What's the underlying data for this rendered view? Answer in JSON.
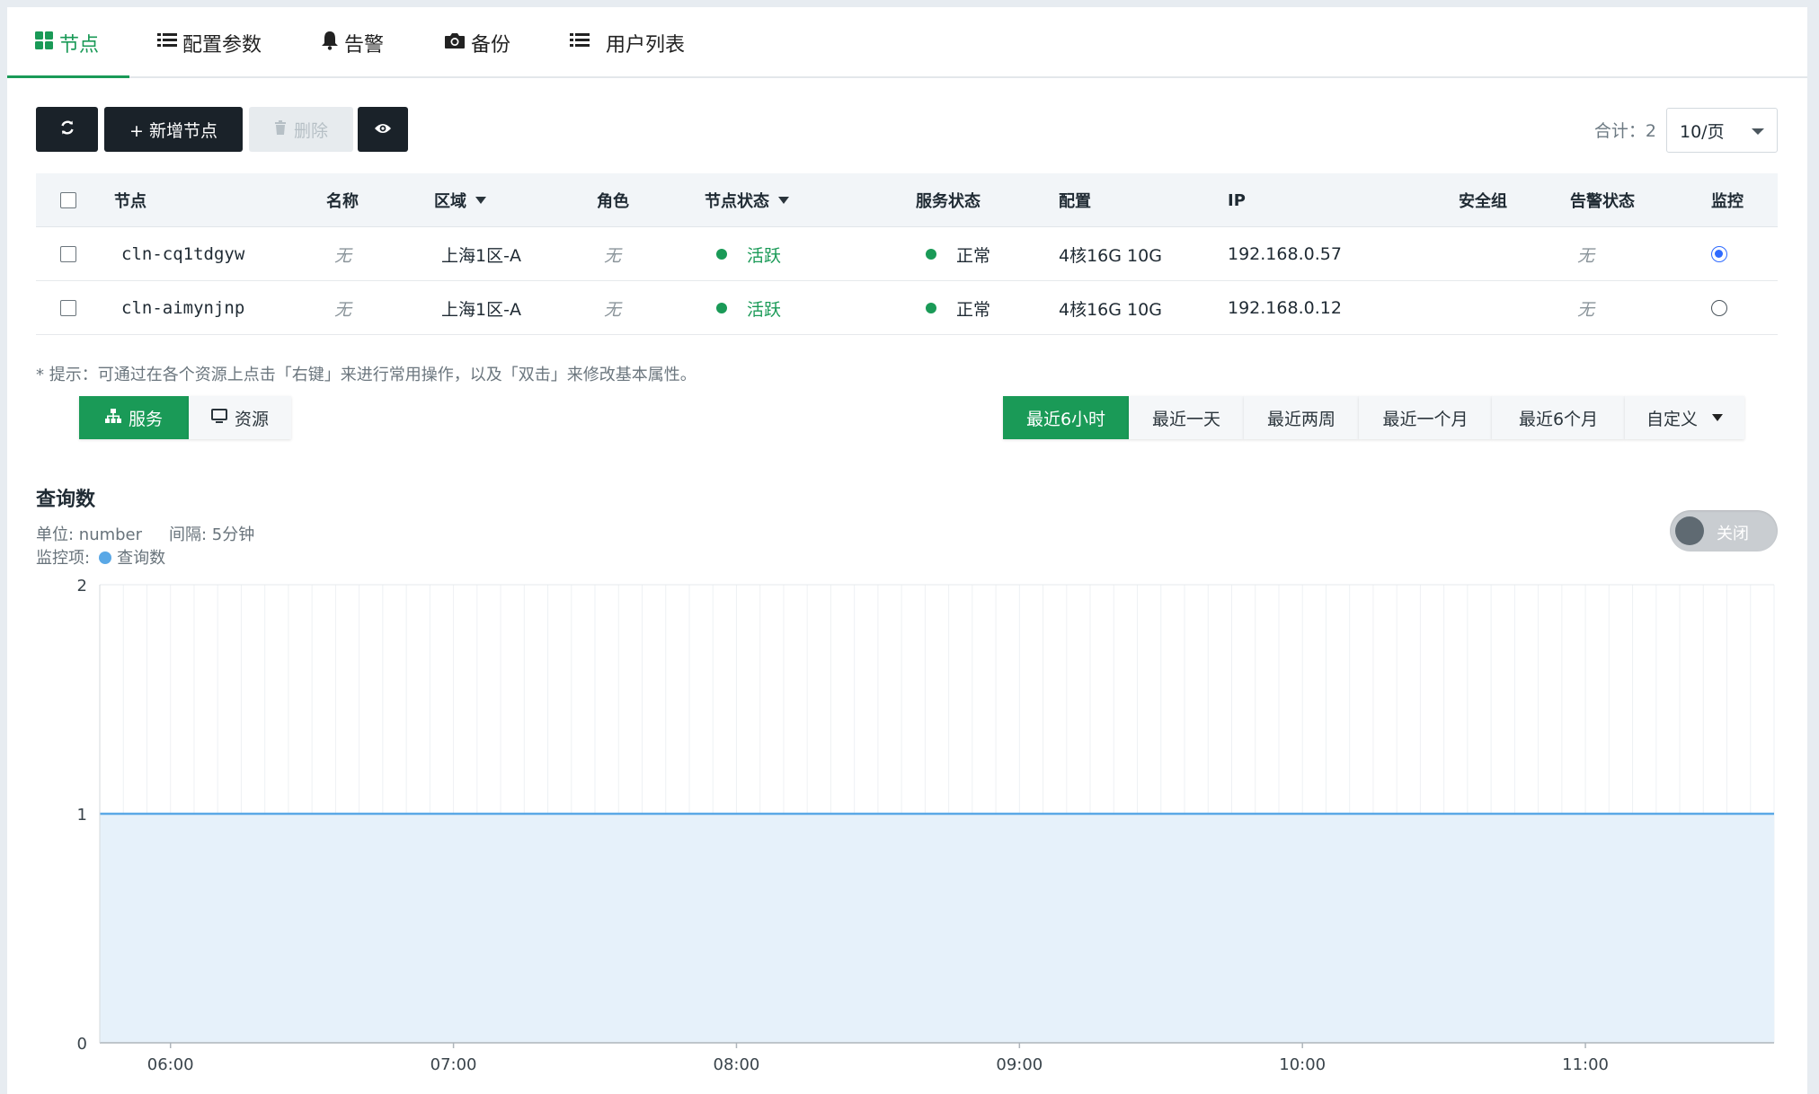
{
  "tabs": [
    {
      "label": "节点",
      "icon": "grid-icon"
    },
    {
      "label": "配置参数",
      "icon": "list-icon"
    },
    {
      "label": "告警",
      "icon": "bell-icon"
    },
    {
      "label": "备份",
      "icon": "camera-icon"
    },
    {
      "label": "用户列表",
      "icon": "list-icon"
    }
  ],
  "toolbar": {
    "refresh_icon": "refresh-icon",
    "add_label": "+ 新增节点",
    "delete_label": "删除",
    "view_icon": "eye-icon",
    "total_label": "合计：2",
    "page_size": "10/页"
  },
  "table": {
    "headers": [
      "节点",
      "名称",
      "区域",
      "角色",
      "节点状态",
      "服务状态",
      "配置",
      "IP",
      "安全组",
      "告警状态",
      "监控"
    ],
    "rows": [
      {
        "node": "cln-cq1tdgyw",
        "name": "无",
        "zone": "上海1区-A",
        "role": "无",
        "node_status": "活跃",
        "service_status": "正常",
        "config": "4核16G 10G",
        "ip": "192.168.0.57",
        "security_group": "",
        "alert_status": "无",
        "monitor_selected": true
      },
      {
        "node": "cln-aimynjnp",
        "name": "无",
        "zone": "上海1区-A",
        "role": "无",
        "node_status": "活跃",
        "service_status": "正常",
        "config": "4核16G 10G",
        "ip": "192.168.0.12",
        "security_group": "",
        "alert_status": "无",
        "monitor_selected": false
      }
    ]
  },
  "hint": "* 提示：可通过在各个资源上点击「右键」来进行常用操作，以及「双击」来修改基本属性。",
  "view_tabs": [
    "服务",
    "资源"
  ],
  "time_ranges": [
    "最近6小时",
    "最近一天",
    "最近两周",
    "最近一个月",
    "最近6个月",
    "自定义"
  ],
  "chart_meta": {
    "unit": "单位: number",
    "interval": "间隔: 5分钟",
    "monitor_label": "监控项:",
    "series_label": "查询数",
    "toggle_label": "关闭"
  },
  "colors": {
    "accent": "#1a9a57",
    "series": "#5aa8e6",
    "fill": "#e6f1fa"
  },
  "chart_data": {
    "type": "area",
    "title": "查询数",
    "x": [
      "05:45",
      "11:40"
    ],
    "xticks": [
      "06:00",
      "07:00",
      "08:00",
      "09:00",
      "10:00",
      "11:00"
    ],
    "ylim": [
      0,
      2
    ],
    "yticks": [
      "0",
      "1",
      "2"
    ],
    "series": [
      {
        "name": "查询数",
        "values": [
          1,
          1
        ]
      }
    ],
    "grid": true,
    "legend": "top-left"
  }
}
